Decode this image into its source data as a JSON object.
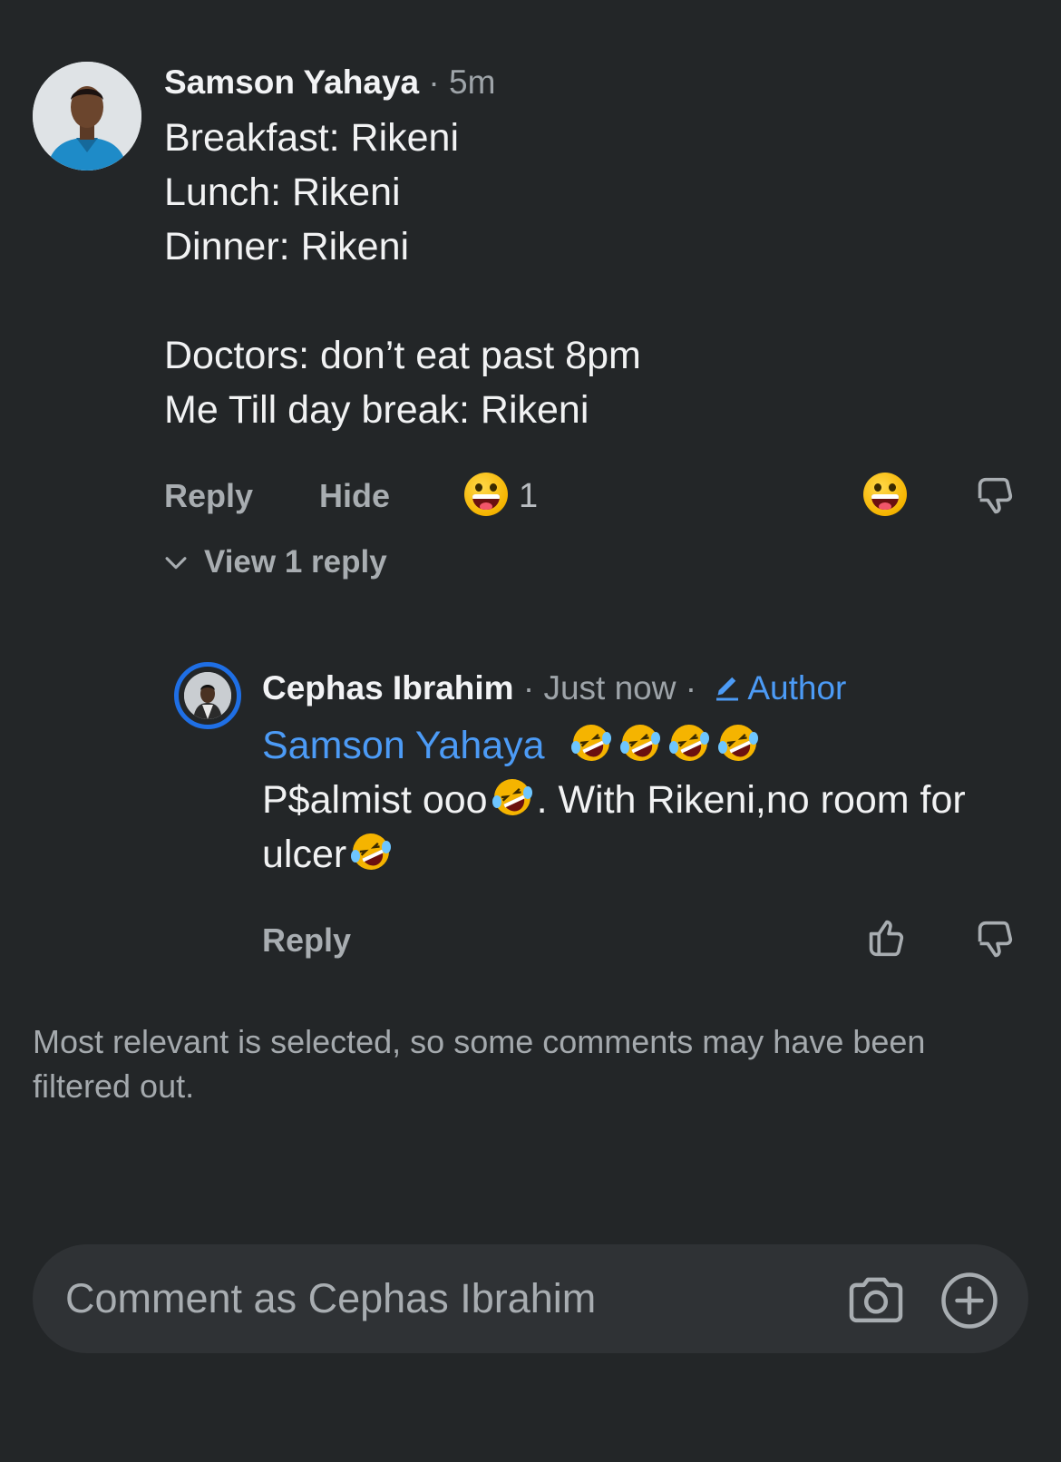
{
  "comment1": {
    "author": "Samson Yahaya",
    "time": "· 5m",
    "lines": [
      "Breakfast: Rikeni",
      "Lunch: Rikeni",
      "Dinner: Rikeni",
      "",
      "Doctors: don’t eat past 8pm",
      "Me Till day break: Rikeni"
    ],
    "reply_label": "Reply",
    "hide_label": "Hide",
    "reaction_count": "1",
    "reaction_emoji": "grinning-squinting-emoji",
    "view_replies_label": "View 1 reply"
  },
  "comment2": {
    "author": "Cephas Ibrahim",
    "time": "· Just now ·",
    "author_badge": "Author",
    "mention": "Samson Yahaya",
    "text_part1": "P$almist ooo",
    "text_part2": ". With Rikeni,no room for",
    "text_part3": "ulcer",
    "reply_label": "Reply",
    "emoji": "rolling-on-floor-laughing-emoji"
  },
  "filter_note": "Most relevant is selected, so some comments may have been filtered out.",
  "composer": {
    "placeholder": "Comment as Cephas Ibrahim"
  },
  "colors": {
    "background": "#232628",
    "accent": "#4c9bf6",
    "ring": "#1f6fe5"
  }
}
